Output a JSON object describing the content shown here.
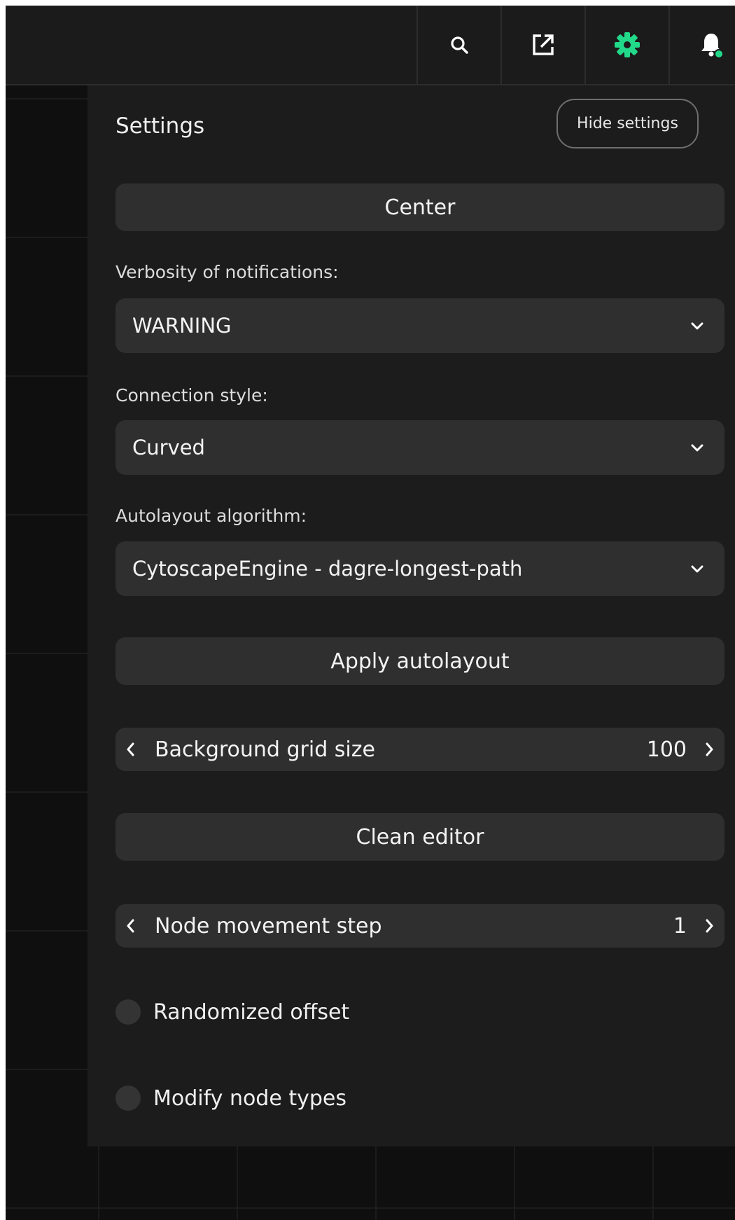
{
  "topbar": {
    "icons": [
      "search-icon",
      "external-link-icon",
      "gear-icon",
      "bell-icon"
    ],
    "active_color": "#22d98a",
    "notification_dot_color": "#22d98a"
  },
  "settings": {
    "title": "Settings",
    "hide_label": "Hide settings",
    "center_label": "Center",
    "verbosity": {
      "label": "Verbosity of notifications:",
      "value": "WARNING"
    },
    "connection": {
      "label": "Connection style:",
      "value": "Curved"
    },
    "autolayout": {
      "label": "Autolayout algorithm:",
      "value": "CytoscapeEngine - dagre-longest-path"
    },
    "apply_label": "Apply autolayout",
    "grid_size": {
      "label": "Background grid size",
      "value": "100"
    },
    "clean_label": "Clean editor",
    "movement_step": {
      "label": "Node movement step",
      "value": "1"
    },
    "randomized_offset": {
      "label": "Randomized offset",
      "checked": false
    },
    "modify_node_types": {
      "label": "Modify node types",
      "checked": false
    }
  }
}
